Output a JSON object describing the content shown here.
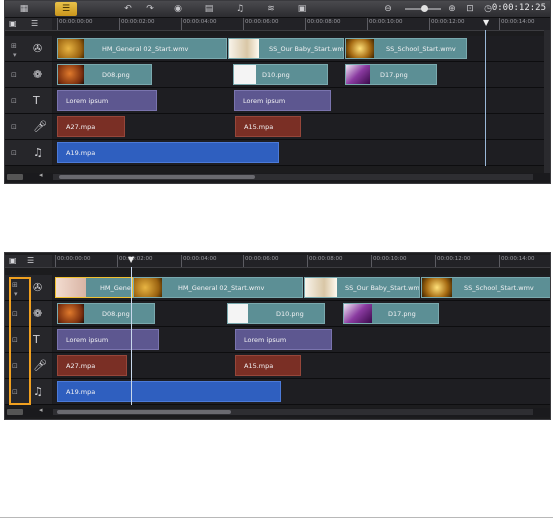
{
  "toolbar": {
    "icons": [
      "storyboard-view-icon",
      "timeline-view-icon",
      "undo-icon",
      "redo-icon",
      "record-capture-icon",
      "sound-mixer-icon",
      "auto-music-icon",
      "audio-waveform-icon",
      "chapter-cue-icon"
    ],
    "timecode": "0:00:12:25",
    "accent": "#e0b030"
  },
  "timeline1": {
    "ruler_labels": [
      "00:00:00:00",
      "00:00:02:00",
      "00:00:04:00",
      "00:00:06:00",
      "00:00:08:00",
      "00:00:10:00",
      "00:00:12:00",
      "00:00:14:00"
    ],
    "video_clips": [
      {
        "label": "HM_General 02_Start.wmv",
        "thumb": "gold"
      },
      {
        "label": "SS_Our Baby_Start.wmv",
        "thumb": "baby"
      },
      {
        "label": "SS_School_Start.wmv",
        "thumb": "school"
      }
    ],
    "overlay_clips": [
      {
        "label": "D08.png",
        "thumb": "ball"
      },
      {
        "label": "D10.png",
        "thumb": "white"
      },
      {
        "label": "D17.png",
        "thumb": "purple"
      }
    ],
    "title_clips": [
      {
        "label": "Lorem ipsum"
      },
      {
        "label": "Lorem ipsum"
      }
    ],
    "voice_clips": [
      {
        "label": "A27.mpa"
      },
      {
        "label": "A15.mpa"
      }
    ],
    "music_clips": [
      {
        "label": "A19.mpa"
      }
    ]
  },
  "timeline2": {
    "ruler_labels": [
      "00:00:00:00",
      "00:00:02:00",
      "00:00:04:00",
      "00:00:06:00",
      "00:00:08:00",
      "00:00:10:00",
      "00:00:12:00",
      "00:00:14:00"
    ],
    "video_clips": [
      {
        "label": "HM_Genera",
        "thumb": "pink"
      },
      {
        "label": "HM_General 02_Start.wmv",
        "thumb": "gold"
      },
      {
        "label": "SS_Our Baby_Start.wmv",
        "thumb": "baby"
      },
      {
        "label": "SS_School_Start.wmv",
        "thumb": "school"
      }
    ],
    "overlay_clips": [
      {
        "label": "D08.png",
        "thumb": "ball"
      },
      {
        "label": "D10.png",
        "thumb": "white"
      },
      {
        "label": "D17.png",
        "thumb": "purple"
      }
    ],
    "title_clips": [
      {
        "label": "Lorem ipsum"
      },
      {
        "label": "Lorem ipsum"
      }
    ],
    "voice_clips": [
      {
        "label": "A27.mpa"
      },
      {
        "label": "A15.mpa"
      }
    ],
    "music_clips": [
      {
        "label": "A19.mpa"
      }
    ]
  }
}
